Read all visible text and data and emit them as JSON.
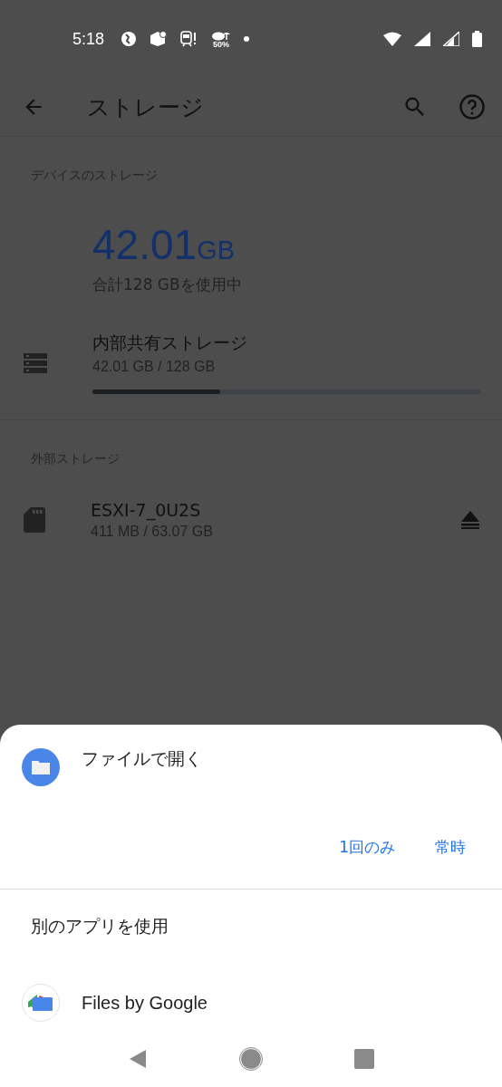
{
  "status_bar": {
    "time": "5:18",
    "weather_percent": "50%"
  },
  "app_bar": {
    "title": "ストレージ"
  },
  "device_storage": {
    "header": "デバイスのストレージ",
    "used_value": "42.01",
    "used_unit": "GB",
    "used_caption": "合計128 GBを使用中",
    "volumes": [
      {
        "name": "内部共有ストレージ",
        "usage": "42.01 GB / 128 GB",
        "level": 0.33
      }
    ]
  },
  "external_storage": {
    "header": "外部ストレージ",
    "volumes": [
      {
        "name": "ESXI-7_0U2S",
        "usage": "411 MB / 63.07 GB"
      }
    ]
  },
  "sheet": {
    "title": "ファイルで開く",
    "buttons": [
      "1回のみ",
      "常時"
    ],
    "other_header": "別のアプリを使用",
    "apps": [
      {
        "name": "Files by Google"
      }
    ]
  }
}
